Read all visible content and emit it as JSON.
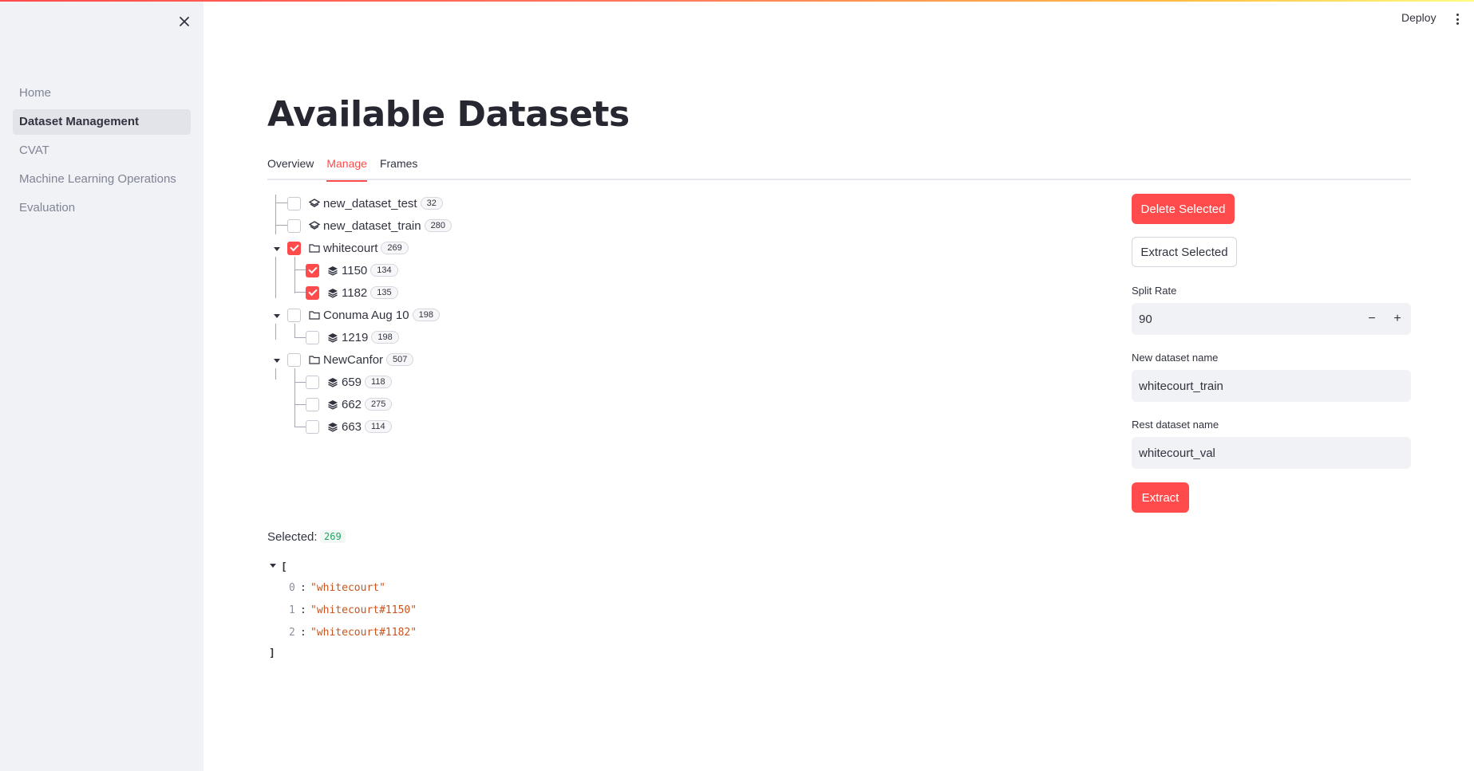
{
  "sidebar": {
    "items": [
      {
        "label": "Home"
      },
      {
        "label": "Dataset Management"
      },
      {
        "label": "CVAT"
      },
      {
        "label": "Machine Learning Operations"
      },
      {
        "label": "Evaluation"
      }
    ],
    "active": "Dataset Management"
  },
  "header": {
    "deploy_label": "Deploy"
  },
  "main": {
    "title": "Available Datasets",
    "tabs": [
      {
        "label": "Overview"
      },
      {
        "label": "Manage"
      },
      {
        "label": "Frames"
      }
    ],
    "active_tab": "Manage"
  },
  "tree": {
    "nodes": [
      {
        "label": "new_dataset_test",
        "count": "32",
        "checked": false,
        "icon": "layer-single-icon"
      },
      {
        "label": "new_dataset_train",
        "count": "280",
        "checked": false,
        "icon": "layer-single-icon"
      },
      {
        "label": "whitecourt",
        "count": "269",
        "checked": true,
        "icon": "folder-icon",
        "expanded": true
      },
      {
        "label": "1150",
        "count": "134",
        "checked": true,
        "icon": "layers-stack-icon"
      },
      {
        "label": "1182",
        "count": "135",
        "checked": true,
        "icon": "layers-stack-icon"
      },
      {
        "label": "Conuma Aug 10",
        "count": "198",
        "checked": false,
        "icon": "folder-icon",
        "expanded": true
      },
      {
        "label": "1219",
        "count": "198",
        "checked": false,
        "icon": "layers-stack-icon"
      },
      {
        "label": "NewCanfor",
        "count": "507",
        "checked": false,
        "icon": "folder-icon",
        "expanded": true
      },
      {
        "label": "659",
        "count": "118",
        "checked": false,
        "icon": "layers-stack-icon"
      },
      {
        "label": "662",
        "count": "275",
        "checked": false,
        "icon": "layers-stack-icon"
      },
      {
        "label": "663",
        "count": "114",
        "checked": false,
        "icon": "layers-stack-icon"
      }
    ]
  },
  "panel": {
    "delete_label": "Delete Selected",
    "extract_selected_label": "Extract Selected",
    "split_rate_label": "Split Rate",
    "split_rate_value": "90",
    "minus": "−",
    "plus": "+",
    "new_name_label": "New dataset name",
    "new_name_value": "whitecourt_train",
    "rest_name_label": "Rest dataset name",
    "rest_name_value": "whitecourt_val",
    "extract_label": "Extract"
  },
  "selection": {
    "label": "Selected:",
    "count": "269",
    "items": [
      {
        "index": "0",
        "value": "\"whitecourt\""
      },
      {
        "index": "1",
        "value": "\"whitecourt#1150\""
      },
      {
        "index": "2",
        "value": "\"whitecourt#1182\""
      }
    ],
    "open_bracket": "[",
    "close_bracket": "]"
  },
  "colors": {
    "accent": "#ff4b4b",
    "sidebar_bg": "#f0f2f6",
    "json_string": "#c9541e",
    "count_green": "#21a366"
  }
}
